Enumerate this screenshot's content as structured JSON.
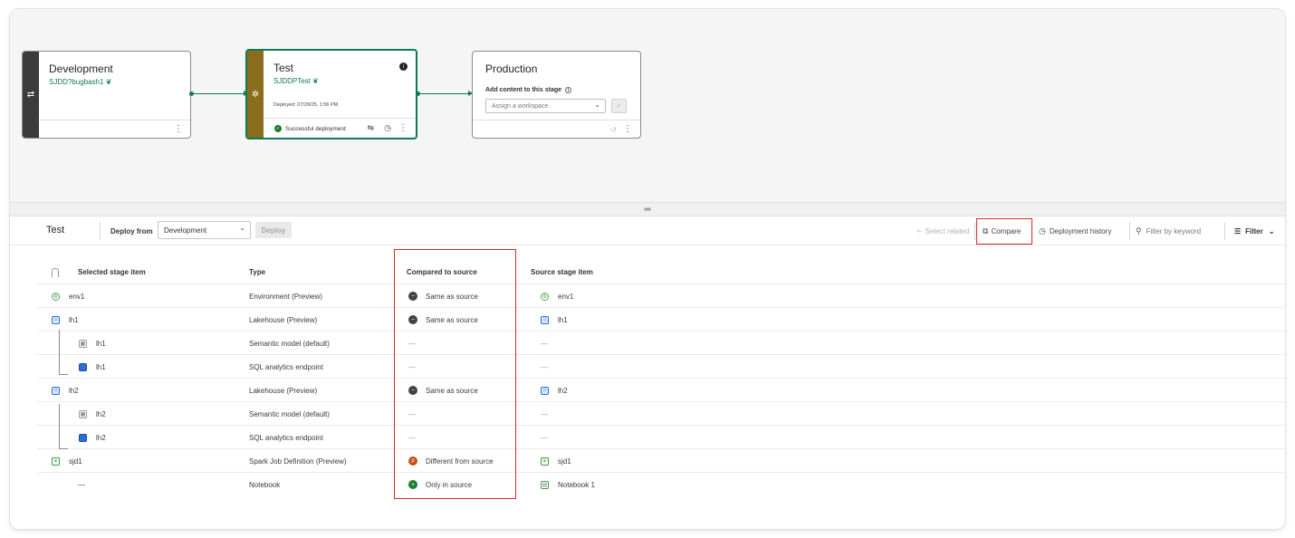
{
  "pipeline": {
    "stages": [
      {
        "name": "Development",
        "workspace": "SJDD?bugbash1 ❦",
        "strip_color": "#3b3b3b"
      },
      {
        "name": "Test",
        "workspace": "SJDDPTest ❦",
        "deployed": "Deployed: 07/29/25, 1:56 PM",
        "status": "Successful deployment",
        "strip_color": "#8a6d1a",
        "accent": "#0e7a5a"
      },
      {
        "name": "Production",
        "add_content_label": "Add content to this stage",
        "assign_placeholder": "Assign a workspace"
      }
    ]
  },
  "toolbar": {
    "stage_title": "Test",
    "deploy_from_label": "Deploy from",
    "deploy_from_value": "Development",
    "deploy_label": "Deploy",
    "select_related_label": "Select related",
    "compare_label": "Compare",
    "history_label": "Deployment history",
    "filter_placeholder": "Filter by keyword",
    "filter_label": "Filter"
  },
  "table": {
    "headers": {
      "selected": "Selected stage item",
      "type": "Type",
      "compared": "Compared to source",
      "source": "Source stage item"
    },
    "rows": [
      {
        "name": "env1",
        "icon": "environment-icon",
        "type": "Environment (Preview)",
        "compare": "Same as source",
        "status": "same",
        "source": "env1",
        "source_icon": "environment-icon"
      },
      {
        "name": "lh1",
        "icon": "lakehouse-icon",
        "type": "Lakehouse (Preview)",
        "compare": "Same as source",
        "status": "same",
        "source": "lh1",
        "source_icon": "lakehouse-icon"
      },
      {
        "name": "lh1",
        "icon": "semantic-model-icon",
        "type": "Semantic model (default)",
        "compare": "—",
        "status": "none",
        "source": "—",
        "child": true
      },
      {
        "name": "lh1",
        "icon": "sql-endpoint-icon",
        "type": "SQL analytics endpoint",
        "compare": "—",
        "status": "none",
        "source": "—",
        "child": true
      },
      {
        "name": "lh2",
        "icon": "lakehouse-icon",
        "type": "Lakehouse (Preview)",
        "compare": "Same as source",
        "status": "same",
        "source": "lh2",
        "source_icon": "lakehouse-icon"
      },
      {
        "name": "lh2",
        "icon": "semantic-model-icon",
        "type": "Semantic model (default)",
        "compare": "—",
        "status": "none",
        "source": "—",
        "child": true
      },
      {
        "name": "lh2",
        "icon": "sql-endpoint-icon",
        "type": "SQL analytics endpoint",
        "compare": "—",
        "status": "none",
        "source": "—",
        "child": true
      },
      {
        "name": "sjd1",
        "icon": "spark-job-icon",
        "type": "Spark Job Definition (Preview)",
        "compare": "Different from source",
        "status": "different",
        "source": "sjd1",
        "source_icon": "spark-job-icon"
      },
      {
        "name": "—",
        "icon": "",
        "type": "Notebook",
        "compare": "Only in source",
        "status": "only",
        "source": "Notebook 1",
        "source_icon": "notebook-icon"
      }
    ]
  },
  "colors": {
    "same": "#424242",
    "different": "#c4501a",
    "only": "#1a7f2e",
    "highlight": "#d42a2a"
  }
}
